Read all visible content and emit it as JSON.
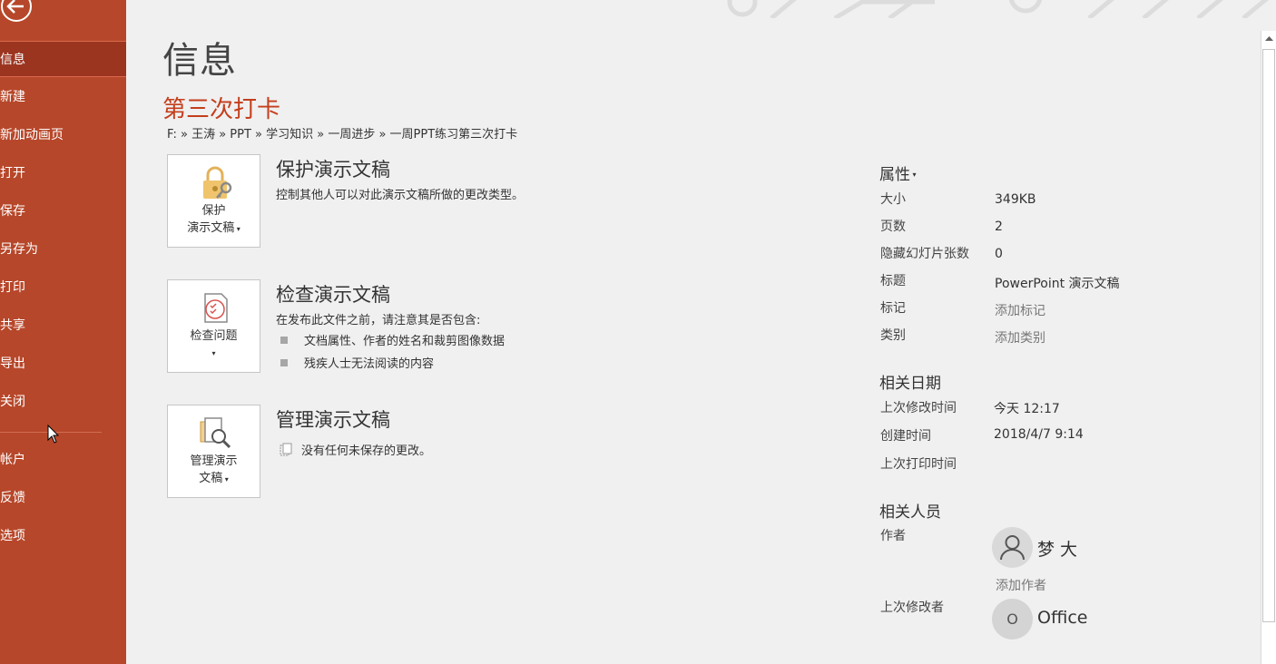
{
  "sidebar": {
    "items": [
      {
        "label": "信息",
        "active": true
      },
      {
        "label": "新建"
      },
      {
        "label": "新加动画页"
      },
      {
        "label": "打开"
      },
      {
        "label": "保存"
      },
      {
        "label": "另存为"
      },
      {
        "label": "打印"
      },
      {
        "label": "共享"
      },
      {
        "label": "导出"
      },
      {
        "label": "关闭"
      },
      {
        "label": "帐户"
      },
      {
        "label": "反馈"
      },
      {
        "label": "选项"
      }
    ],
    "back_icon": "back-arrow-icon"
  },
  "main": {
    "title": "信息",
    "doc_name": "第三次打卡",
    "breadcrumb": "F: » 王涛 » PPT » 学习知识 » 一周进步 » 一周PPT练习第三次打卡",
    "sections": {
      "protect": {
        "tile_label_1": "保护",
        "tile_label_2": "演示文稿",
        "title": "保护演示文稿",
        "desc": "控制其他人可以对此演示文稿所做的更改类型。",
        "icon": "lock-key-icon"
      },
      "inspect": {
        "tile_label_1": "检查问题",
        "title": "检查演示文稿",
        "desc": "在发布此文件之前，请注意其是否包含:",
        "bullets": [
          "文档属性、作者的姓名和裁剪图像数据",
          "残疾人士无法阅读的内容"
        ],
        "icon": "inspect-document-icon"
      },
      "manage": {
        "tile_label_1": "管理演示",
        "tile_label_2": "文稿",
        "title": "管理演示文稿",
        "desc": "没有任何未保存的更改。",
        "icon": "manage-document-icon"
      }
    }
  },
  "properties": {
    "heading": "属性",
    "rows": [
      {
        "label": "大小",
        "value": "349KB"
      },
      {
        "label": "页数",
        "value": "2"
      },
      {
        "label": "隐藏幻灯片张数",
        "value": "0"
      },
      {
        "label": "标题",
        "value": "PowerPoint 演示文稿"
      },
      {
        "label": "标记",
        "value": "添加标记"
      },
      {
        "label": "类别",
        "value": "添加类别"
      }
    ]
  },
  "dates": {
    "heading": "相关日期",
    "rows": [
      {
        "label": "上次修改时间",
        "value": "今天 12:17"
      },
      {
        "label": "创建时间",
        "value": "2018/4/7 9:14"
      },
      {
        "label": "上次打印时间",
        "value": ""
      }
    ]
  },
  "people": {
    "heading": "相关人员",
    "author_label": "作者",
    "author_name": "梦 大",
    "add_author": "添加作者",
    "last_modified_label": "上次修改者",
    "last_modified_name": "Office",
    "last_modified_initial": "O"
  },
  "colors": {
    "accent": "#b7472a",
    "doc_name": "#c43e1c"
  }
}
